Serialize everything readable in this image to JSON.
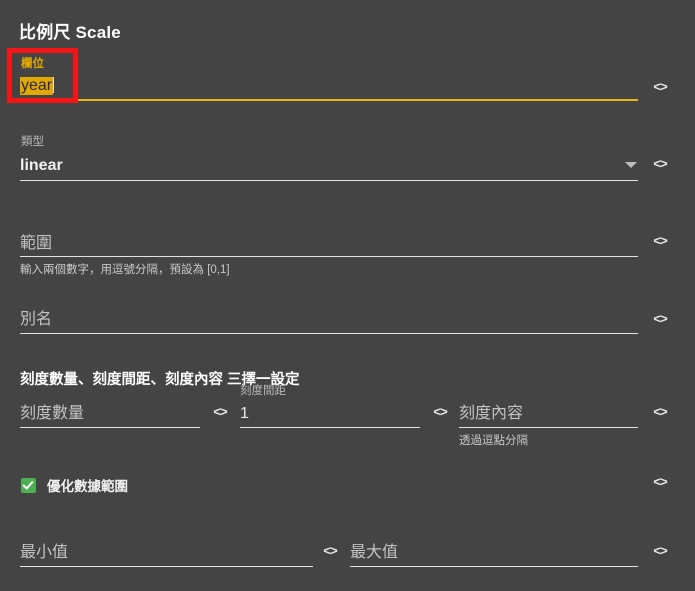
{
  "panel": {
    "title": "比例尺 Scale",
    "background_color": "#444444",
    "accent_color": "#e8b611",
    "annotation_color": "#f41616",
    "checkbox_color": "#4caf50"
  },
  "icons": {
    "code": "<>",
    "dropdown": "▼"
  },
  "fields": {
    "field": {
      "label": "欄位",
      "value": "year",
      "selected": true,
      "focused": true
    },
    "type": {
      "label": "類型",
      "value": "linear",
      "options": [
        "linear"
      ]
    },
    "range": {
      "placeholder": "範圍",
      "value": "",
      "helper": "輸入兩個數字，用逗號分隔，預設為 [0,1]"
    },
    "alias": {
      "placeholder": "別名",
      "value": ""
    }
  },
  "ticks_section": {
    "heading": "刻度數量、刻度間距、刻度內容 三擇一設定",
    "tick_count": {
      "placeholder": "刻度數量",
      "value": ""
    },
    "tick_step": {
      "label": "刻度間距",
      "value": "1"
    },
    "tick_values": {
      "placeholder": "刻度內容",
      "value": "",
      "helper": "透過逗點分隔"
    }
  },
  "nice_option": {
    "label": "優化數據範圍",
    "checked": true
  },
  "minmax": {
    "min": {
      "placeholder": "最小值",
      "value": ""
    },
    "max": {
      "placeholder": "最大值",
      "value": ""
    }
  }
}
